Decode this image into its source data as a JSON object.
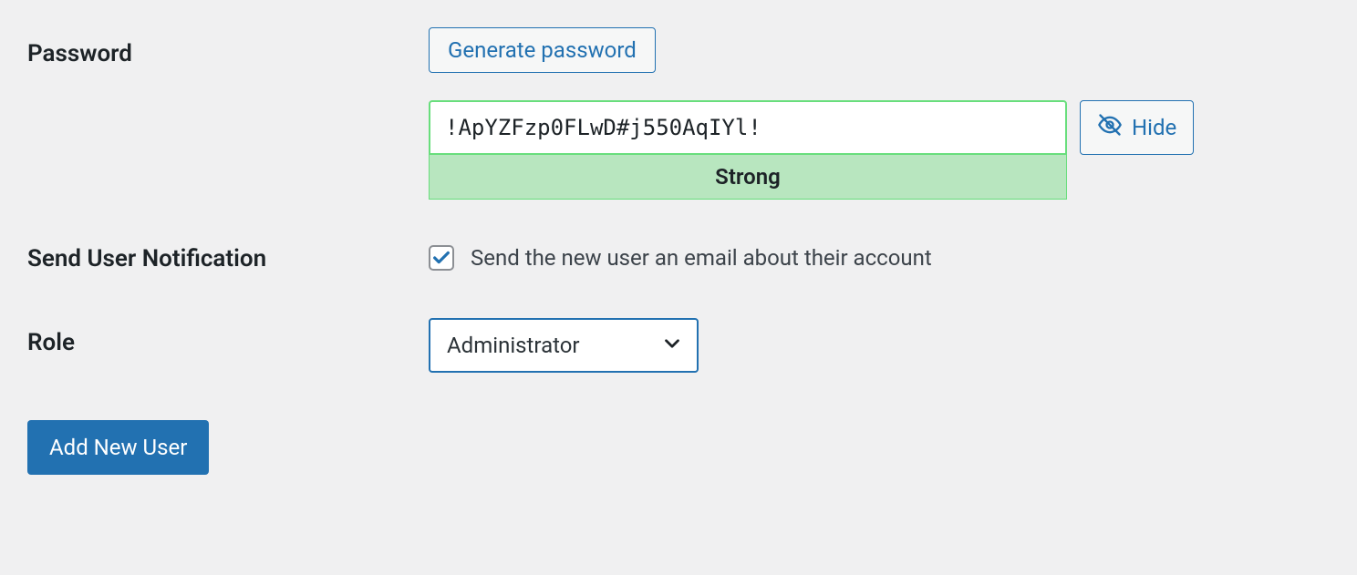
{
  "password": {
    "label": "Password",
    "generate_button": "Generate password",
    "value": "!ApYZFzp0FLwD#j550AqIYl!",
    "strength": "Strong",
    "hide_button": "Hide"
  },
  "notification": {
    "label": "Send User Notification",
    "checkbox_label": "Send the new user an email about their account",
    "checked": true
  },
  "role": {
    "label": "Role",
    "selected": "Administrator"
  },
  "submit": {
    "label": "Add New User"
  },
  "colors": {
    "accent": "#2271b1",
    "strength_bg": "#b8e6bf",
    "strength_border": "#68de7c"
  }
}
